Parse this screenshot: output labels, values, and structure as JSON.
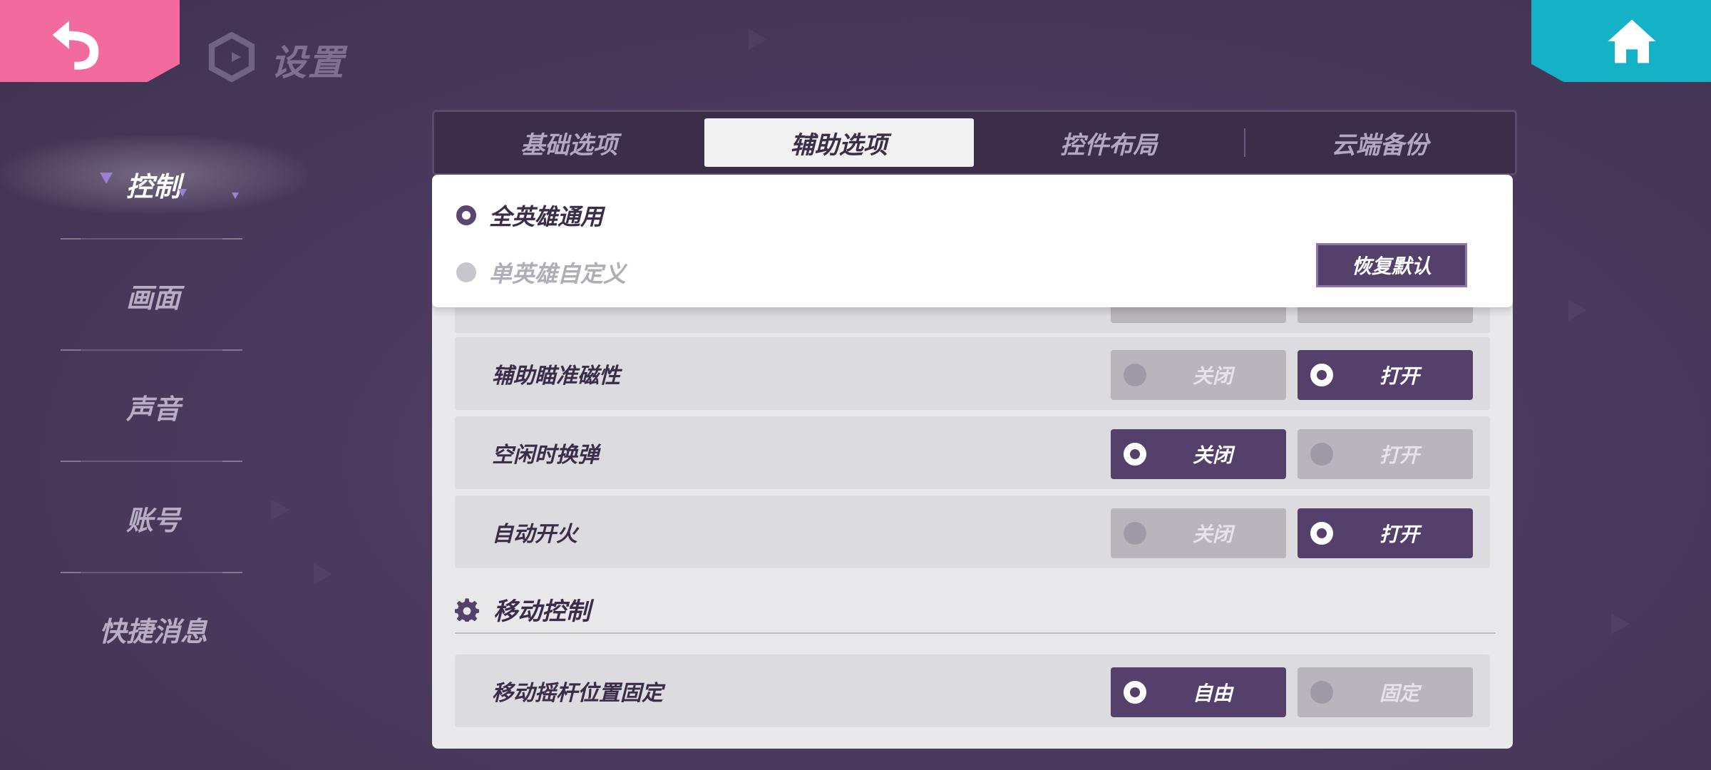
{
  "header": {
    "title": "设置"
  },
  "sidebar": {
    "items": [
      {
        "label": "控制",
        "active": true
      },
      {
        "label": "画面"
      },
      {
        "label": "声音"
      },
      {
        "label": "账号"
      },
      {
        "label": "快捷消息"
      }
    ]
  },
  "tabs": [
    {
      "label": "基础选项"
    },
    {
      "label": "辅助选项",
      "active": true
    },
    {
      "label": "控件布局"
    },
    {
      "label": "云端备份"
    }
  ],
  "mode": {
    "options": [
      {
        "label": "全英雄通用",
        "selected": true
      },
      {
        "label": "单英雄自定义",
        "selected": false
      }
    ],
    "reset_label": "恢复默认"
  },
  "settings": [
    {
      "label": "辅助瞄准磁性",
      "off_label": "关闭",
      "on_label": "打开",
      "value": "打开"
    },
    {
      "label": "空闲时换弹",
      "off_label": "关闭",
      "on_label": "打开",
      "value": "关闭"
    },
    {
      "label": "自动开火",
      "off_label": "关闭",
      "on_label": "打开",
      "value": "打开"
    }
  ],
  "move_section": {
    "title": "移动控制",
    "rows": [
      {
        "label": "移动摇杆位置固定",
        "opt_a": "自由",
        "opt_b": "固定",
        "value": "自由"
      }
    ]
  },
  "colors": {
    "back": "#f26a9e",
    "home": "#15b1c7",
    "accent": "#54406b"
  }
}
